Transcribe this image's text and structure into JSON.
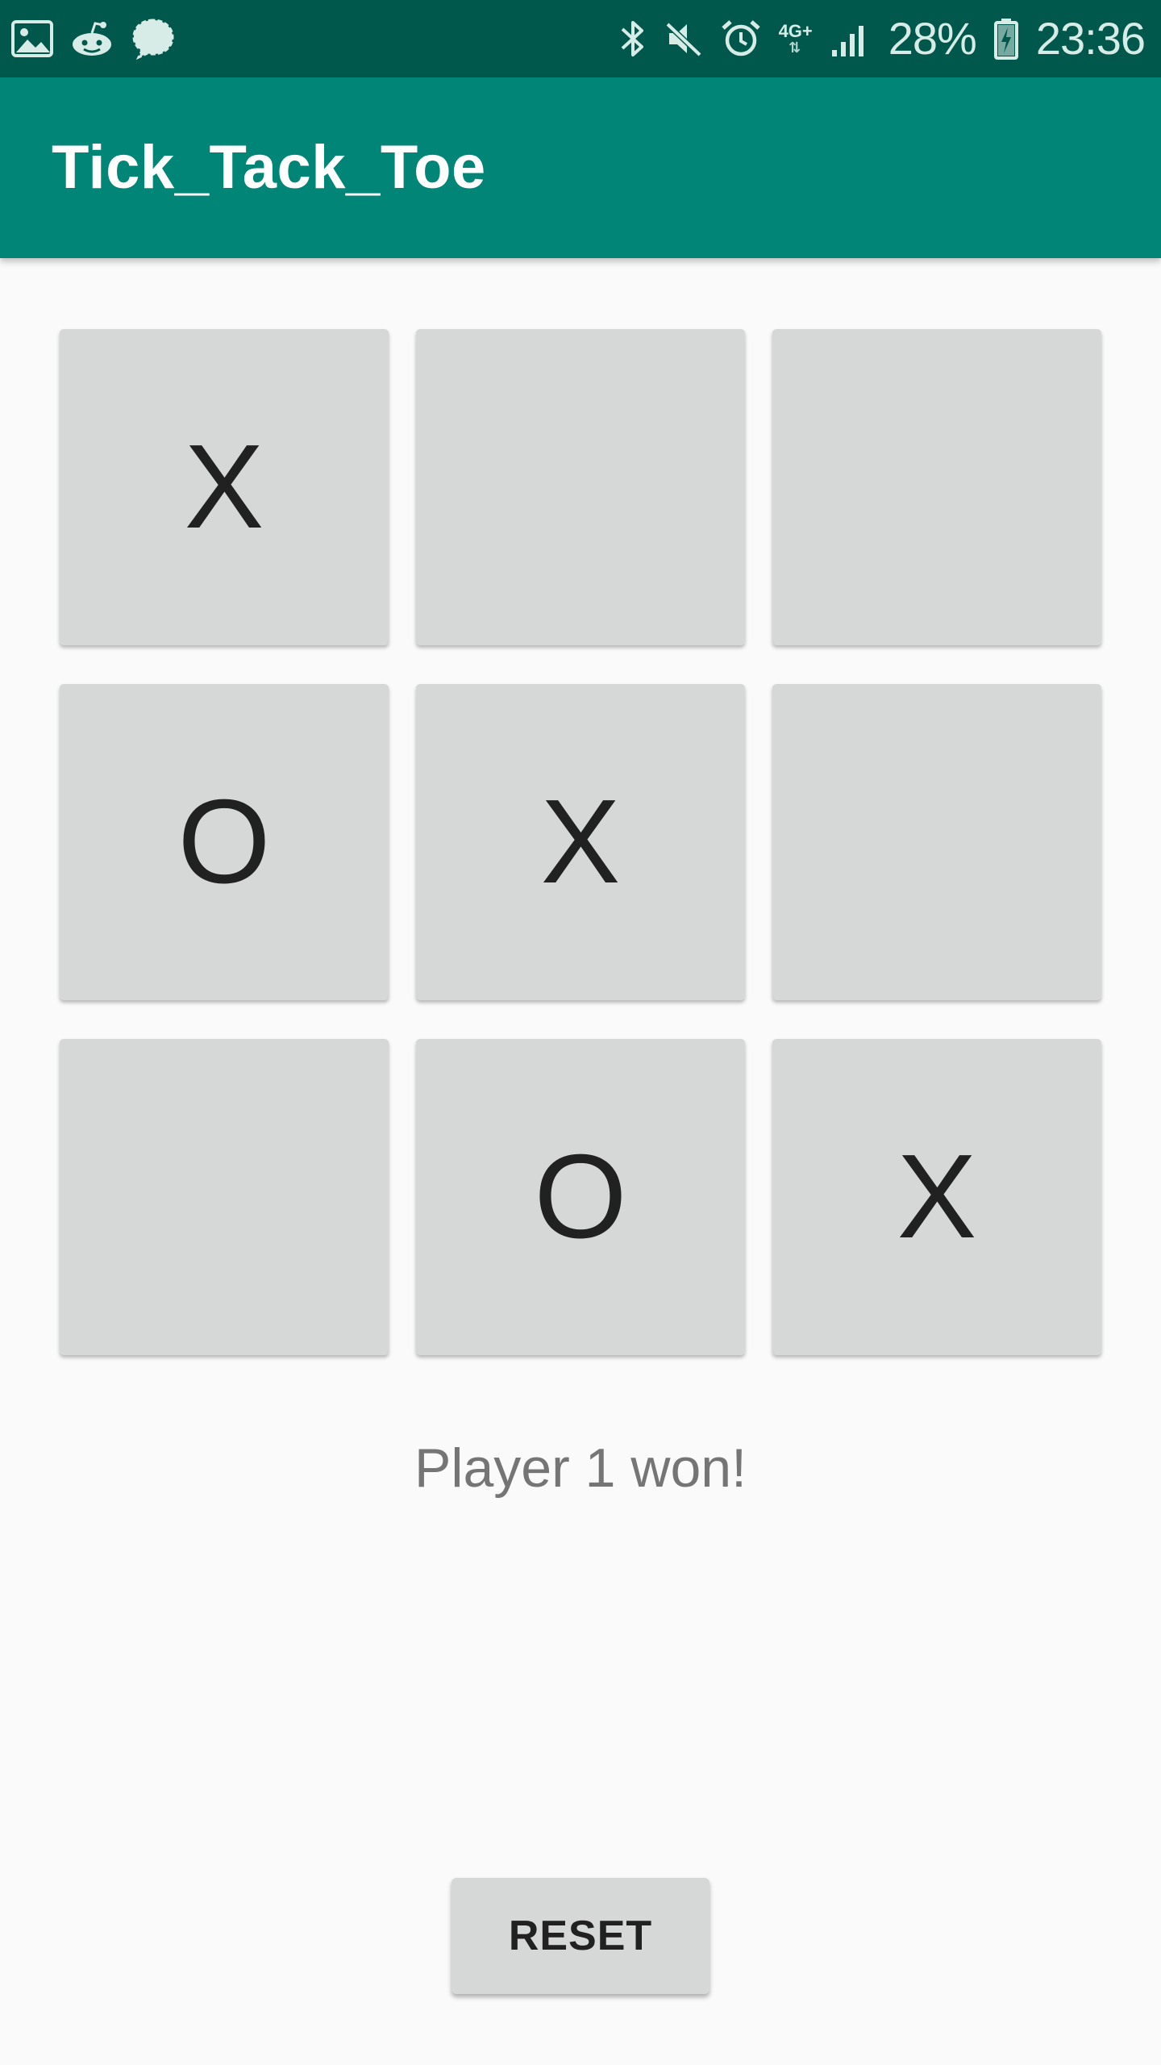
{
  "status_bar": {
    "notification_icons": [
      "gallery-icon",
      "reddit-icon",
      "signal-messenger-icon"
    ],
    "system_icons": [
      "bluetooth-icon",
      "mute-icon",
      "alarm-icon",
      "network-4g-icon",
      "cell-signal-icon",
      "battery-charging-icon"
    ],
    "network_label": "4G+",
    "battery_percent": "28%",
    "time": "23:36"
  },
  "app_bar": {
    "title": "Tick_Tack_Toe",
    "color": "#008577"
  },
  "board": {
    "cells": [
      [
        "X",
        "",
        ""
      ],
      [
        "O",
        "X",
        ""
      ],
      [
        "",
        "O",
        "X"
      ]
    ]
  },
  "game_status": "Player 1 won!",
  "reset_button": {
    "label": "RESET"
  },
  "colors": {
    "status_bar": "#00574B",
    "app_bar": "#008577",
    "cell_background": "#D6D7D7",
    "background": "#FAFAFA",
    "mark_text": "#212121",
    "status_text": "#757575"
  }
}
